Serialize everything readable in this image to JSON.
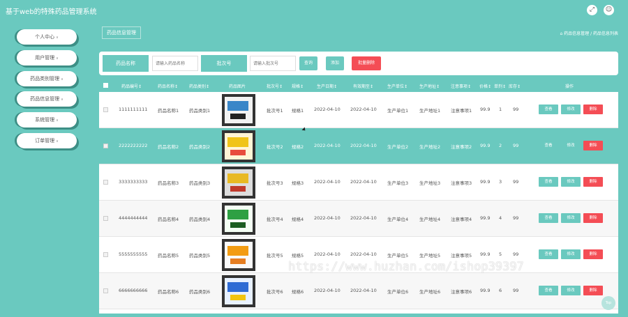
{
  "app": {
    "title": "基于web的特殊药品管理系统"
  },
  "topbar": {
    "icons": [
      "fullscreen-icon",
      "user-icon"
    ]
  },
  "sidebar": {
    "items": [
      {
        "label": "个人中心"
      },
      {
        "label": "用户管理"
      },
      {
        "label": "药品类别管理"
      },
      {
        "label": "药品信息管理"
      },
      {
        "label": "系统管理"
      },
      {
        "label": "订单管理"
      }
    ]
  },
  "header": {
    "page_tag": "药品信息管理",
    "breadcrumb": "药品信息管理 / 药品信息列表"
  },
  "search": {
    "name_label": "药品名称",
    "name_placeholder": "请输入药品名称",
    "batch_label": "批次号",
    "batch_placeholder": "请输入批次号",
    "query_button": "查询",
    "add_button": "添加",
    "batch_delete_button": "批量删除"
  },
  "table": {
    "columns": [
      "药品编号",
      "药品名称",
      "药品类别",
      "药品图片",
      "批次号",
      "规格",
      "生产日期",
      "有效期至",
      "生产单位",
      "生产地址",
      "注意事项",
      "价格",
      "单剂",
      "库存",
      "操作"
    ],
    "sort_mark": "↕",
    "row_actions": {
      "view": "查看",
      "edit": "修改",
      "delete": "删除"
    },
    "rows": [
      {
        "code": "1111111111",
        "name": "药品名称1",
        "category": "药品类别1",
        "batch": "批次号1",
        "spec": "规格1",
        "mfg_date": "2022-04-10",
        "exp_date": "2022-04-10",
        "maker": "生产单位1",
        "address": "生产地址1",
        "notes": "注意事项1",
        "price": "99.9",
        "dose": "1",
        "stock": "99"
      },
      {
        "code": "2222222222",
        "name": "药品名称2",
        "category": "药品类别2",
        "batch": "批次号2",
        "spec": "规格2",
        "mfg_date": "2022-04-10",
        "exp_date": "2022-04-10",
        "maker": "生产单位2",
        "address": "生产地址2",
        "notes": "注意事项2",
        "price": "99.9",
        "dose": "2",
        "stock": "99"
      },
      {
        "code": "3333333333",
        "name": "药品名称3",
        "category": "药品类别3",
        "batch": "批次号3",
        "spec": "规格3",
        "mfg_date": "2022-04-10",
        "exp_date": "2022-04-10",
        "maker": "生产单位3",
        "address": "生产地址3",
        "notes": "注意事项3",
        "price": "99.9",
        "dose": "3",
        "stock": "99"
      },
      {
        "code": "4444444444",
        "name": "药品名称4",
        "category": "药品类别4",
        "batch": "批次号4",
        "spec": "规格4",
        "mfg_date": "2022-04-10",
        "exp_date": "2022-04-10",
        "maker": "生产单位4",
        "address": "生产地址4",
        "notes": "注意事项4",
        "price": "99.9",
        "dose": "4",
        "stock": "99"
      },
      {
        "code": "5555555555",
        "name": "药品名称5",
        "category": "药品类别5",
        "batch": "批次号5",
        "spec": "规格5",
        "mfg_date": "2022-04-10",
        "exp_date": "2022-04-10",
        "maker": "生产单位5",
        "address": "生产地址5",
        "notes": "注意事项5",
        "price": "99.9",
        "dose": "5",
        "stock": "99"
      },
      {
        "code": "6666666666",
        "name": "药品名称6",
        "category": "药品类别6",
        "batch": "批次号6",
        "spec": "规格6",
        "mfg_date": "2022-04-10",
        "exp_date": "2022-04-10",
        "maker": "生产单位6",
        "address": "生产地址6",
        "notes": "注意事项6",
        "price": "99.9",
        "dose": "6",
        "stock": "99"
      }
    ]
  },
  "watermark": "https://www.huzhan.com/ishop39397",
  "fab": {
    "label": "Top"
  },
  "colors": {
    "accent": "#6ac9bf",
    "danger": "#f44d55",
    "row_highlight": "#6ac9bf"
  }
}
